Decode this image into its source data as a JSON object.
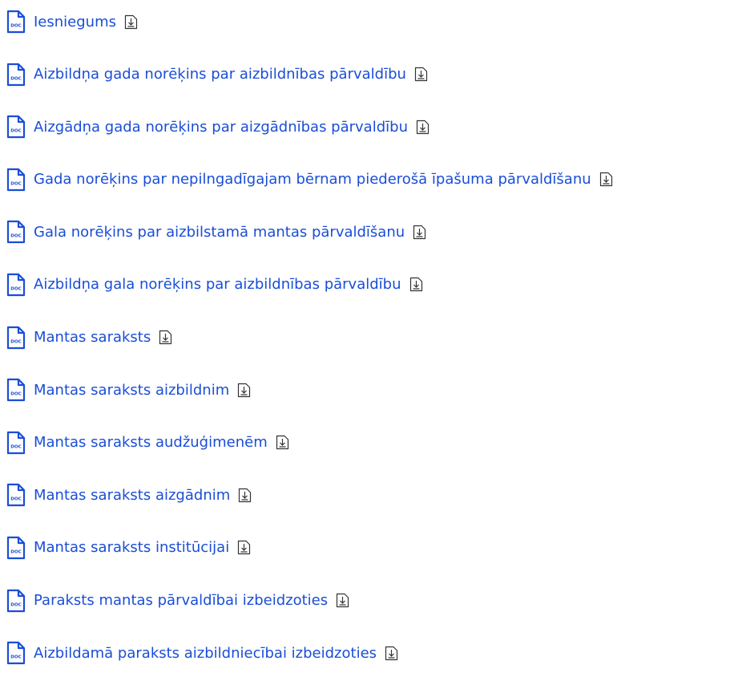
{
  "documents": {
    "items": [
      {
        "label": "Iesniegums",
        "file_badge": "DOC"
      },
      {
        "label": "Aizbildņa gada norēķins par aizbildnības pārvaldību",
        "file_badge": "DOC"
      },
      {
        "label": "Aizgādņa gada norēķins par aizgādnības pārvaldību",
        "file_badge": "DOC"
      },
      {
        "label": "Gada norēķins par nepilngadīgajam bērnam piederošā īpašuma pārvaldīšanu",
        "file_badge": "DOC"
      },
      {
        "label": "Gala norēķins par aizbilstamā mantas pārvaldīšanu",
        "file_badge": "DOC"
      },
      {
        "label": "Aizbildņa gala norēķins par aizbildnības pārvaldību",
        "file_badge": "DOC"
      },
      {
        "label": "Mantas saraksts",
        "file_badge": "DOC"
      },
      {
        "label": "Mantas saraksts aizbildnim",
        "file_badge": "DOC"
      },
      {
        "label": "Mantas saraksts audžuģimenēm",
        "file_badge": "DOC"
      },
      {
        "label": "Mantas saraksts aizgādnim",
        "file_badge": "DOC"
      },
      {
        "label": "Mantas saraksts institūcijai",
        "file_badge": "DOC"
      },
      {
        "label": "Paraksts mantas pārvaldībai izbeidzoties",
        "file_badge": "DOC"
      },
      {
        "label": "Aizbildamā paraksts aizbildniecībai izbeidzoties",
        "file_badge": "DOC"
      }
    ]
  },
  "colors": {
    "link": "#1a4ed8",
    "icon": "#1a4ed8",
    "background": "#ffffff"
  },
  "icons": {
    "file": "doc-file-icon",
    "download": "download-icon"
  }
}
